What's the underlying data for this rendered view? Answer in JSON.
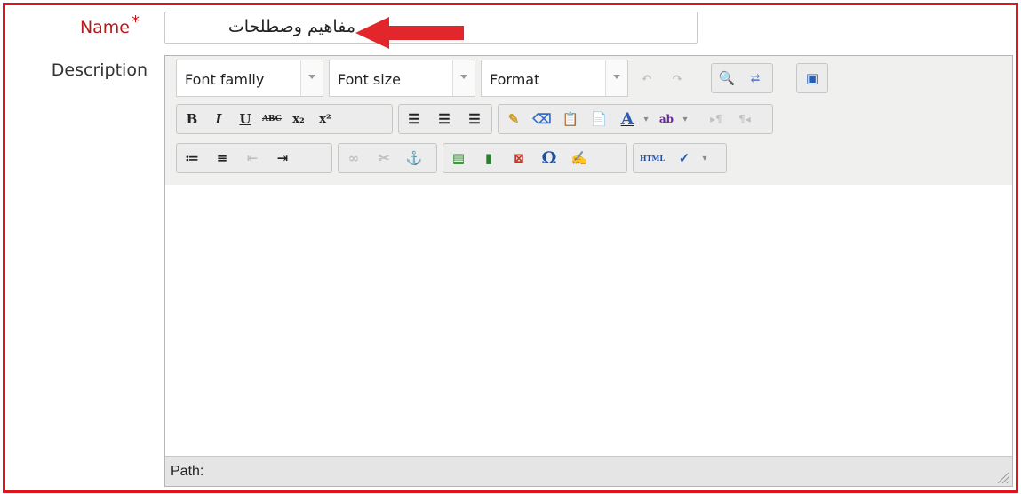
{
  "form": {
    "name_label": "Name",
    "required_mark": "*",
    "name_value": "مفاهيم وصطلحات",
    "description_label": "Description"
  },
  "editor": {
    "selects": {
      "font_family": "Font family",
      "font_size": "Font size",
      "format": "Format"
    },
    "buttons": {
      "bold": "B",
      "italic": "I",
      "underline": "U",
      "strike": "ABC",
      "subscript": "x₂",
      "superscript": "x²",
      "font_color": "A",
      "html": "HTML",
      "special_char": "Ω"
    },
    "path_label": "Path:"
  },
  "colors": {
    "highlight_border": "#e0141c",
    "arrow": "#e3262b"
  }
}
